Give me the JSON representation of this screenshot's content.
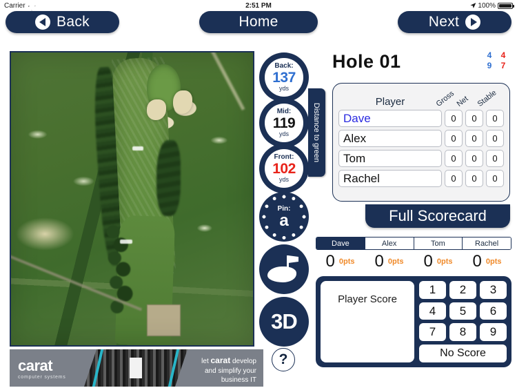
{
  "status_bar": {
    "carrier": "Carrier",
    "wifi_icon": "wifi-icon",
    "time": "2:51 PM",
    "location_icon": "location-arrow-icon",
    "battery_percent": "100%",
    "battery_icon": "battery-full-icon"
  },
  "nav": {
    "back_label": "Back",
    "home_label": "Home",
    "next_label": "Next",
    "back_icon": "chevron-left-circle-icon",
    "next_icon": "chevron-right-circle-icon"
  },
  "map": {
    "name": "hole-aerial-map"
  },
  "distances": {
    "tab_label": "Distance to green",
    "unit": "yds",
    "items": [
      {
        "label": "Back:",
        "value": "137",
        "unit": "yds",
        "color": "#2f6fd0"
      },
      {
        "label": "Mid:",
        "value": "119",
        "unit": "yds",
        "color": "#111111"
      },
      {
        "label": "Front:",
        "value": "102",
        "unit": "yds",
        "color": "#e8231a"
      }
    ]
  },
  "pin": {
    "label": "Pin:",
    "value": "a"
  },
  "view_buttons": {
    "green_view_icon": "green-flag-icon",
    "three_d_label": "3D"
  },
  "help": {
    "label": "?"
  },
  "hole": {
    "title": "Hole 01",
    "par_grid": [
      {
        "value": "4",
        "color": "#2f6fd0"
      },
      {
        "value": "4",
        "color": "#e8231a"
      },
      {
        "value": "9",
        "color": "#2f6fd0"
      },
      {
        "value": "7",
        "color": "#e8231a"
      }
    ]
  },
  "scorecard": {
    "columns": [
      "Player",
      "Gross",
      "Net",
      "Stable"
    ],
    "rows": [
      {
        "player": "Dave",
        "gross": "0",
        "net": "0",
        "stable": "0",
        "active": true
      },
      {
        "player": "Alex",
        "gross": "0",
        "net": "0",
        "stable": "0",
        "active": false
      },
      {
        "player": "Tom",
        "gross": "0",
        "net": "0",
        "stable": "0",
        "active": false
      },
      {
        "player": "Rachel",
        "gross": "0",
        "net": "0",
        "stable": "0",
        "active": false
      }
    ],
    "full_scorecard_label": "Full Scorecard"
  },
  "player_tabs": [
    {
      "name": "Dave",
      "selected": true,
      "score": "0",
      "points": "0pts"
    },
    {
      "name": "Alex",
      "selected": false,
      "score": "0",
      "points": "0pts"
    },
    {
      "name": "Tom",
      "selected": false,
      "score": "0",
      "points": "0pts"
    },
    {
      "name": "Rachel",
      "selected": false,
      "score": "0",
      "points": "0pts"
    }
  ],
  "keypad": {
    "score_box_label": "Player Score",
    "keys": [
      "1",
      "2",
      "3",
      "4",
      "5",
      "6",
      "7",
      "8",
      "9"
    ],
    "no_score_label": "No Score"
  },
  "banner": {
    "logo_name": "carat",
    "logo_sub": "computer systems",
    "line1_pre": "let ",
    "line1_brand": "carat",
    "line1_post": " develop",
    "line2": "and simplify your",
    "line3": "business IT"
  },
  "colors": {
    "navy": "#1b3055",
    "orange": "#f08a2a",
    "blue": "#2f6fd0",
    "red": "#e8231a"
  }
}
